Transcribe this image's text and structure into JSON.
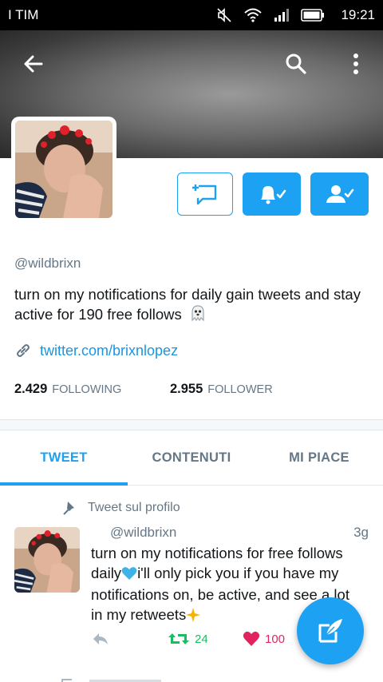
{
  "status_bar": {
    "carrier": "I TIM",
    "time": "19:21",
    "icons": [
      "mute-icon",
      "wifi-icon",
      "signal-icon",
      "battery-icon"
    ]
  },
  "header": {
    "back_icon": "arrow-left-icon",
    "search_icon": "search-icon",
    "more_icon": "overflow-menu-icon"
  },
  "profile": {
    "handle": "@wildbrixn",
    "bio": "turn on my notifications for daily gain tweets and stay active for 190 free follows",
    "bio_emoji": "ghost-emoji",
    "link": "twitter.com/brixnlopez",
    "following_count": "2.429",
    "following_label": "FOLLOWING",
    "followers_count": "2.955",
    "followers_label": "FOLLOWER"
  },
  "actions": {
    "message_icon": "direct-message-icon",
    "notifications_icon": "bell-check-icon",
    "follow_icon": "user-check-icon"
  },
  "tabs": [
    {
      "label": "TWEET",
      "active": true
    },
    {
      "label": "CONTENUTI",
      "active": false
    },
    {
      "label": "MI PIACE",
      "active": false
    }
  ],
  "pinned": {
    "label": "Tweet sul profilo"
  },
  "tweet": {
    "handle": "@wildbrixn",
    "time": "3g",
    "text_part1": "turn on my notifications for free follows daily",
    "text_part2": "i'll only pick you if you have my notifications on, be active, and see a lot in my retweets",
    "retweets": "24",
    "likes": "100"
  },
  "colors": {
    "accent": "#1da1f2",
    "retweet": "#17bf63",
    "like": "#e0245e",
    "muted": "#657786"
  }
}
